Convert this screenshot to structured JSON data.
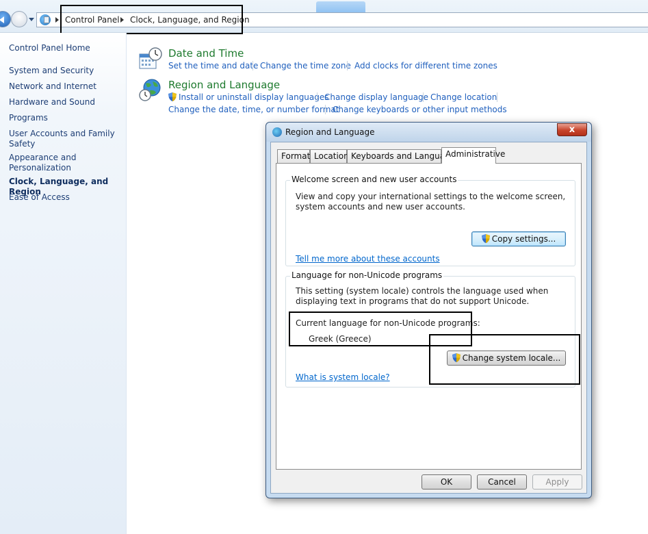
{
  "address_bar": {
    "crumbs": [
      "Control Panel",
      "Clock, Language, and Region"
    ]
  },
  "left_nav": {
    "home": "Control Panel Home",
    "items": [
      "System and Security",
      "Network and Internet",
      "Hardware and Sound",
      "Programs",
      "User Accounts and Family Safety",
      "Appearance and Personalization",
      "Clock, Language, and Region",
      "Ease of Access"
    ],
    "current_index": 6
  },
  "categories": {
    "date_time": {
      "title": "Date and Time",
      "icon": "calendar-clock-icon",
      "links": [
        "Set the time and date",
        "Change the time zone",
        "Add clocks for different time zones"
      ]
    },
    "region_language": {
      "title": "Region and Language",
      "icon": "globe-clock-icon",
      "links": [
        "Install or uninstall display languages",
        "Change display language",
        "Change location",
        "Change the date, time, or number format",
        "Change keyboards or other input methods"
      ]
    }
  },
  "dialog": {
    "title": "Region and Language",
    "close_label": "x",
    "tabs": [
      "Formats",
      "Location",
      "Keyboards and Languages",
      "Administrative"
    ],
    "active_tab": "Administrative",
    "welcome_group": {
      "label": "Welcome screen and new user accounts",
      "description": "View and copy your international settings to the welcome screen, system accounts and new user accounts.",
      "button": "Copy settings...",
      "link": "Tell me more about these accounts"
    },
    "unicode_group": {
      "label": "Language for non-Unicode programs",
      "description": "This setting (system locale) controls the language used when displaying text in programs that do not support Unicode.",
      "current_label": "Current language for non-Unicode programs:",
      "current_value": "Greek (Greece)",
      "button": "Change system locale...",
      "link": "What is system locale?"
    },
    "footer": {
      "ok": "OK",
      "cancel": "Cancel",
      "apply": "Apply"
    }
  },
  "colors": {
    "link": "#1f5fbd",
    "category_title": "#1e7a2e",
    "annotation_box": "#000000"
  }
}
